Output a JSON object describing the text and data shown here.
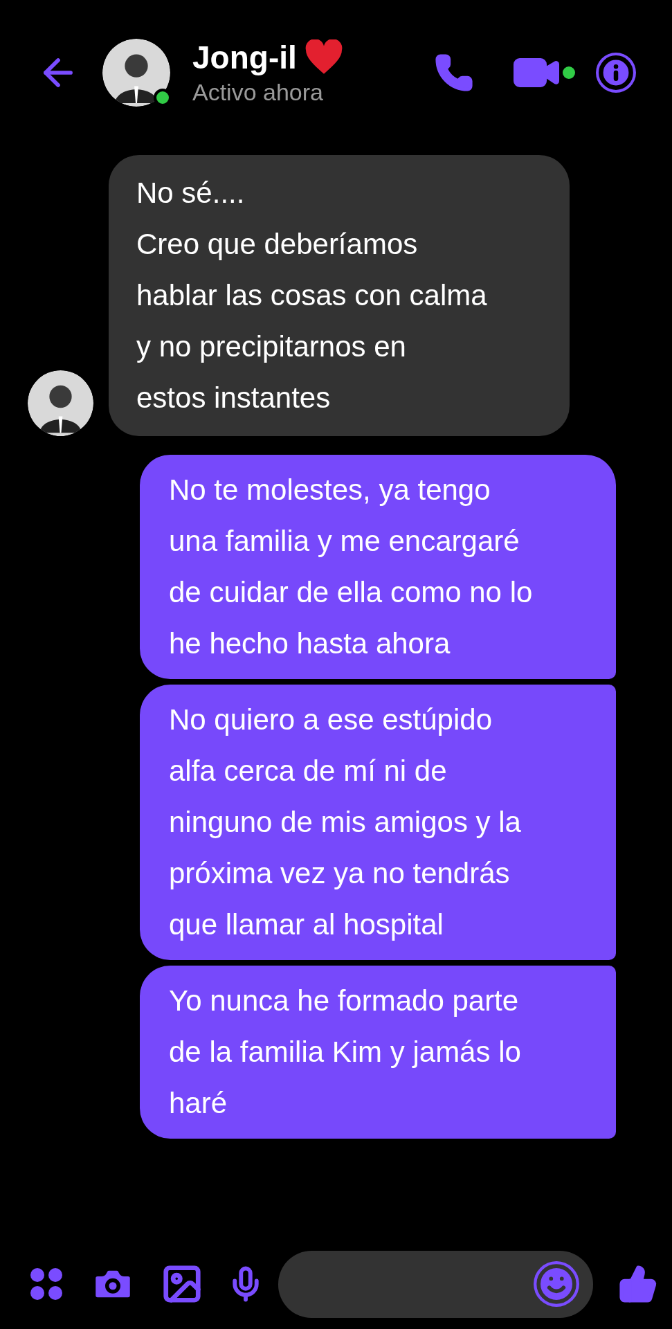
{
  "header": {
    "contact_name": "Jong-il",
    "status": "Activo ahora",
    "online": true
  },
  "messages": [
    {
      "kind": "incoming",
      "lines": [
        "No sé....",
        "Creo que deberíamos",
        "hablar las cosas con calma",
        "y no precipitarnos en",
        "estos instantes"
      ]
    },
    {
      "kind": "outgoing",
      "lines": [
        "No te molestes, ya tengo",
        "una familia y me encargaré",
        "de cuidar de ella como no lo",
        "he hecho hasta ahora"
      ]
    },
    {
      "kind": "outgoing",
      "lines": [
        "No quiero a ese estúpido",
        "alfa cerca de mí ni de",
        "ninguno de mis amigos y la",
        "próxima vez ya no tendrás",
        "que llamar al hospital"
      ]
    },
    {
      "kind": "outgoing",
      "lines": [
        "Yo nunca he formado parte",
        "de la familia Kim y jamás lo",
        "haré"
      ]
    }
  ]
}
